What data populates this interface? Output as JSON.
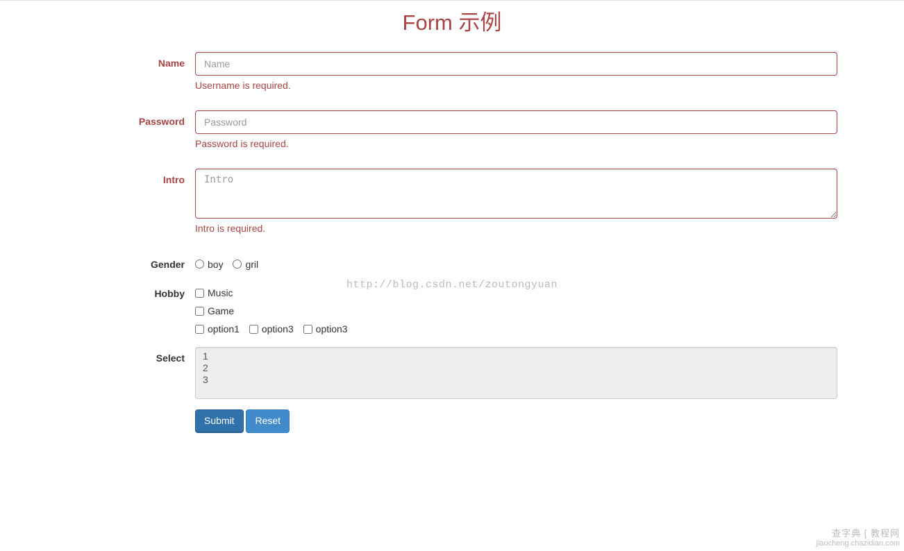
{
  "header": {
    "title": "Form 示例"
  },
  "fields": {
    "name": {
      "label": "Name",
      "placeholder": "Name",
      "error": "Username is required."
    },
    "password": {
      "label": "Password",
      "placeholder": "Password",
      "error": "Password is required."
    },
    "intro": {
      "label": "Intro",
      "placeholder": "Intro",
      "error": "Intro is required."
    },
    "gender": {
      "label": "Gender",
      "options": [
        "boy",
        "gril"
      ]
    },
    "hobby": {
      "label": "Hobby",
      "block_options": [
        "Music",
        "Game"
      ],
      "inline_options": [
        "option1",
        "option3",
        "option3"
      ]
    },
    "select": {
      "label": "Select",
      "options": [
        "1",
        "2",
        "3"
      ]
    }
  },
  "buttons": {
    "submit": "Submit",
    "reset": "Reset"
  },
  "watermarks": {
    "url": "http://blog.csdn.net/zoutongyuan",
    "corner_line1": "查字典 [ 教程网",
    "corner_line2": "jiaocheng.chazidian.com"
  }
}
